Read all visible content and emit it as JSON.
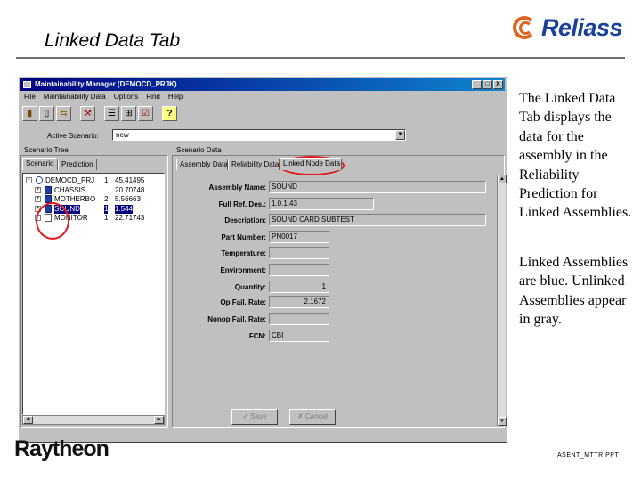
{
  "slide": {
    "title": "Linked Data Tab",
    "logo_text": "Reliass",
    "footer_brand": "Raytheon",
    "footer_code": "ASENT_MTTR.PPT",
    "description_1": "The Linked Data Tab displays the data for the assembly in the Reliability Prediction for Linked Assemblies.",
    "description_2": "Linked Assemblies are blue. Unlinked Assemblies appear in gray."
  },
  "window": {
    "title": "Maintainability Manager (DEMOCD_PRJK)",
    "controls": {
      "minimize": "_",
      "maximize": "□",
      "close": "X"
    },
    "menu": [
      "File",
      "Maintainability Data",
      "Options",
      "Find",
      "Help"
    ],
    "toolbar_icons": [
      "exit-icon",
      "new-icon",
      "save-icon",
      "tools-icon",
      "list-icon",
      "tree-icon",
      "checklist-icon",
      "help-icon"
    ],
    "toolbar_glyphs": [
      "▮",
      "▯",
      "⇆",
      "⚒",
      "☰",
      "⊞",
      "☑",
      "?"
    ]
  },
  "scenario": {
    "active_label": "Active Scenario:",
    "active_value": "new",
    "arrow": "▼"
  },
  "scenario_tree": {
    "label": "Scenario Tree",
    "tabs": [
      "Scenario",
      "Prediction"
    ],
    "expanders": {
      "collapsed": "+",
      "expanded": "−"
    },
    "scroll": {
      "left": "◄",
      "right": "►",
      "up": "▲",
      "down": "▼"
    },
    "rows": [
      {
        "name": "DEMOCD_PRJ",
        "qty": "1",
        "value": "45.41495",
        "level": 0,
        "icon": "root",
        "expander": "expanded",
        "selected": false
      },
      {
        "name": "CHASSIS",
        "qty": "",
        "value": "20.70748",
        "level": 1,
        "icon": "linked",
        "expander": "collapsed",
        "selected": false
      },
      {
        "name": "MOTHERBO",
        "qty": "2",
        "value": "5.56663",
        "level": 1,
        "icon": "linked",
        "expander": "collapsed",
        "selected": false
      },
      {
        "name": "SOUND",
        "qty": "1",
        "value": "1.544",
        "level": 1,
        "icon": "linked",
        "expander": "collapsed",
        "selected": true
      },
      {
        "name": "MONITOR",
        "qty": "1",
        "value": "22.71743",
        "level": 1,
        "icon": "unlinked",
        "expander": "collapsed",
        "selected": false
      }
    ]
  },
  "scenario_data": {
    "label": "Scenario Data",
    "tabs": [
      "Assembly Data",
      "Reliability Data",
      "Linked Node Data"
    ],
    "fields": [
      {
        "label": "Assembly Name:",
        "value": "SOUND",
        "align": "left"
      },
      {
        "label": "Full Ref. Des.:",
        "value": "1.0.1.43",
        "align": "left"
      },
      {
        "label": "Description:",
        "value": "SOUND CARD SUBTEST",
        "align": "left"
      },
      {
        "label": "Part Number:",
        "value": "PN0017",
        "align": "left"
      },
      {
        "label": "Temperature:",
        "value": "",
        "align": "left"
      },
      {
        "label": "Environment:",
        "value": "",
        "align": "left"
      },
      {
        "label": "Quantity:",
        "value": "1",
        "align": "right"
      },
      {
        "label": "Op Fail. Rate:",
        "value": "2.1672",
        "align": "right"
      },
      {
        "label": "Nonop Fail. Rate:",
        "value": "",
        "align": "left"
      },
      {
        "label": "FCN:",
        "value": "CBI",
        "align": "left"
      }
    ],
    "buttons": {
      "save": "Save",
      "cancel": "Cancel",
      "save_icon": "✓",
      "cancel_icon": "✗"
    }
  }
}
